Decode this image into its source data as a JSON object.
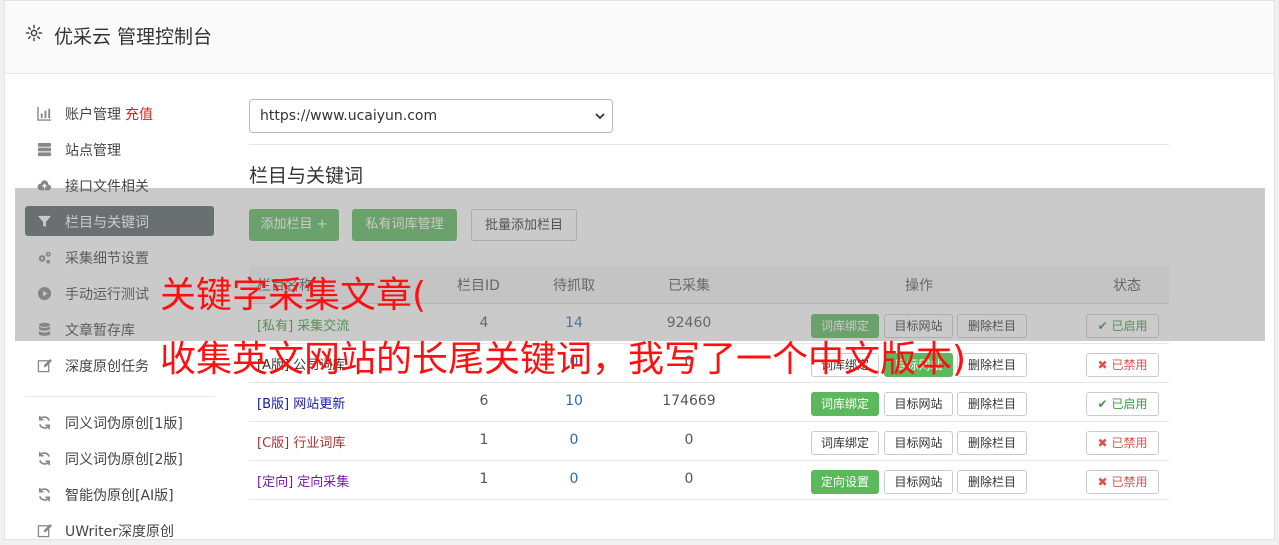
{
  "header": {
    "title": "优采云 管理控制台"
  },
  "sidebar": {
    "items": [
      {
        "label": "账户管理",
        "extra": "充值",
        "icon": "bar-chart-icon"
      },
      {
        "label": "站点管理",
        "icon": "server-icon"
      },
      {
        "label": "接口文件相关",
        "icon": "cloud-upload-icon"
      },
      {
        "label": "栏目与关键词",
        "icon": "filter-icon",
        "active": true
      },
      {
        "label": "采集细节设置",
        "icon": "gears-icon"
      },
      {
        "label": "手动运行测试",
        "icon": "play-circle-icon"
      },
      {
        "label": "文章暂存库",
        "icon": "database-icon"
      },
      {
        "label": "深度原创任务",
        "icon": "edit-icon"
      },
      {
        "label": "同义词伪原创[1版]",
        "icon": "refresh-icon"
      },
      {
        "label": "同义词伪原创[2版]",
        "icon": "refresh-icon"
      },
      {
        "label": "智能伪原创[AI版]",
        "icon": "refresh-icon"
      },
      {
        "label": "UWriter深度原创",
        "icon": "edit-icon"
      }
    ]
  },
  "site_select": {
    "value": "https://www.ucaiyun.com"
  },
  "section": {
    "title": "栏目与关键词"
  },
  "buttons": {
    "add": "添加栏目 +",
    "private": "私有词库管理",
    "batch": "批量添加栏目"
  },
  "table": {
    "headers": {
      "name": "栏目名称",
      "id": "栏目ID",
      "pending": "待抓取",
      "collected": "已采集",
      "ops": "操作",
      "status": "状态"
    },
    "rows": [
      {
        "tag": "[私有]",
        "name": "采集交流",
        "id": "4",
        "pending": "14",
        "collected": "92460",
        "op1": "词库绑定",
        "op1_active": true,
        "op2": "目标网站",
        "op2_active": false,
        "op3": "删除栏目",
        "status": "已启用",
        "enabled": true,
        "color": "#3a9a3a"
      },
      {
        "tag": "[A版]",
        "name": "公司词库",
        "id": "",
        "pending": "0",
        "collected": "0",
        "op1": "词库绑定",
        "op1_active": false,
        "op2": "目标网站",
        "op2_active": true,
        "op3": "删除栏目",
        "status": "已禁用",
        "enabled": false,
        "color": "#333333"
      },
      {
        "tag": "[B版]",
        "name": "网站更新",
        "id": "6",
        "pending": "10",
        "collected": "174669",
        "op1": "词库绑定",
        "op1_active": true,
        "op2": "目标网站",
        "op2_active": false,
        "op3": "删除栏目",
        "status": "已启用",
        "enabled": true,
        "color": "#1a1aa8"
      },
      {
        "tag": "[C版]",
        "name": "行业词库",
        "id": "1",
        "pending": "0",
        "collected": "0",
        "op1": "词库绑定",
        "op1_active": false,
        "op2": "目标网站",
        "op2_active": false,
        "op3": "删除栏目",
        "status": "已禁用",
        "enabled": false,
        "color": "#a83232"
      },
      {
        "tag": "[定向]",
        "name": "定向采集",
        "id": "1",
        "pending": "0",
        "collected": "0",
        "op1": "定向设置",
        "op1_active": true,
        "op2": "目标网站",
        "op2_active": false,
        "op3": "删除栏目",
        "status": "已禁用",
        "enabled": false,
        "color": "#7a1aa8"
      }
    ]
  },
  "overlay_text": {
    "line1": "关键字采集文章(",
    "line2": "收集英文网站的长尾关键词，我写了一个中文版本)"
  }
}
